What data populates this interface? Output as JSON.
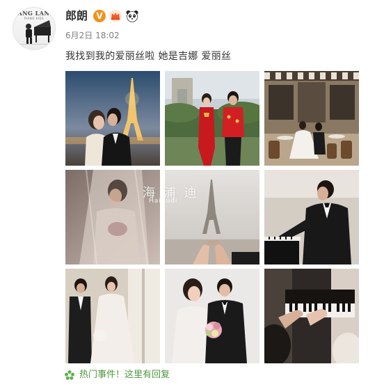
{
  "user": {
    "name": "郎朗",
    "avatar_logo": "LANG LANG",
    "avatar_logo_sub": "PIANO KIDS",
    "verified_badge": "V",
    "badge_icons": [
      "verified-icon",
      "crown-icon",
      "panda-icon"
    ]
  },
  "post": {
    "time": "6月2日 18:02",
    "text": "我找到我的爱丽丝啦 她是吉娜 爱丽丝",
    "photos": [
      {
        "scene": "eiffel-tower-night-couple"
      },
      {
        "scene": "arc-de-triomphe-red-qipao-couple"
      },
      {
        "scene": "paris-cafe-terrace-couple"
      },
      {
        "scene": "bride-veil-portrait"
      },
      {
        "scene": "eiffel-tower-pinky-promise"
      },
      {
        "scene": "man-playing-piano"
      },
      {
        "scene": "bride-groom-window"
      },
      {
        "scene": "bride-groom-bouquet-studio"
      },
      {
        "scene": "hands-on-piano-keys"
      }
    ],
    "watermark": "海 浦 迪",
    "watermark_sub": "Haipudi"
  },
  "footer": {
    "icon": "hot-event-flower-icon",
    "text": "热门事件！这里有回复"
  },
  "colors": {
    "username": "#333333",
    "time": "#808080",
    "footer_text": "#4c9a3b",
    "verified_badge": "#f0931f"
  }
}
